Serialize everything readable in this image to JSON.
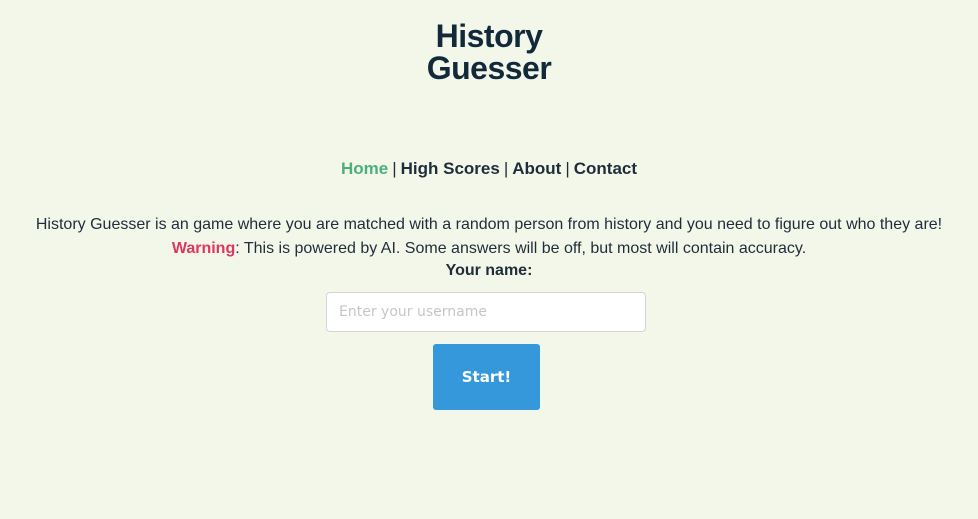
{
  "logo": {
    "line1": "History",
    "line2": "Guesser"
  },
  "nav": {
    "items": [
      {
        "label": "Home",
        "active": true
      },
      {
        "label": "High Scores",
        "active": false
      },
      {
        "label": "About",
        "active": false
      },
      {
        "label": "Contact",
        "active": false
      }
    ],
    "separator": "|"
  },
  "intro": {
    "description": "History Guesser is an game where you are matched with a random person from history and you need to figure out who they are!",
    "warning_label": "Warning",
    "warning_text": ": This is powered by AI. Some answers will be off, but most will contain accuracy."
  },
  "form": {
    "name_label": "Your name:",
    "username_placeholder": "Enter your username",
    "username_value": "",
    "start_label": "Start!"
  },
  "colors": {
    "background": "#f3f7ea",
    "accent_active": "#4caf7c",
    "warning": "#e0365e",
    "button": "#3498db",
    "logo": "#12293a"
  }
}
